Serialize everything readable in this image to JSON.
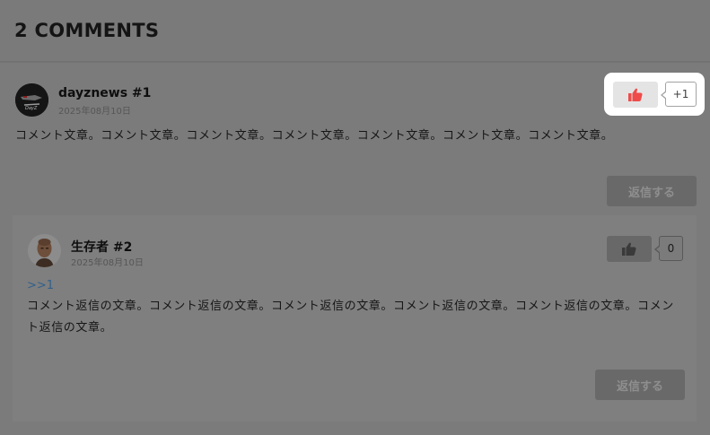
{
  "section": {
    "title": "2 COMMENTS"
  },
  "comments": [
    {
      "author": "dayznews #1",
      "date": "2025年08月10日",
      "body": "コメント文章。コメント文章。コメント文章。コメント文章。コメント文章。コメント文章。コメント文章。",
      "like_count": "+1",
      "reply_label": "返信する",
      "avatar": "dayznews-logo-avatar",
      "like_icon": "thumbs-up-icon",
      "like_icon_color": "#ef4b4b"
    },
    {
      "author": "生存者 #2",
      "date": "2025年08月10日",
      "quote": ">>1",
      "body": "コメント返信の文章。コメント返信の文章。コメント返信の文章。コメント返信の文章。コメント返信の文章。コメント返信の文章。",
      "like_count": "0",
      "reply_label": "返信する",
      "avatar": "survivor-portrait-avatar",
      "like_icon": "thumbs-up-icon",
      "like_icon_color": "#3a3a3a"
    }
  ],
  "colors": {
    "overlay": "#7a7a7a",
    "highlight": "#ffffff",
    "link": "#315f8c"
  }
}
